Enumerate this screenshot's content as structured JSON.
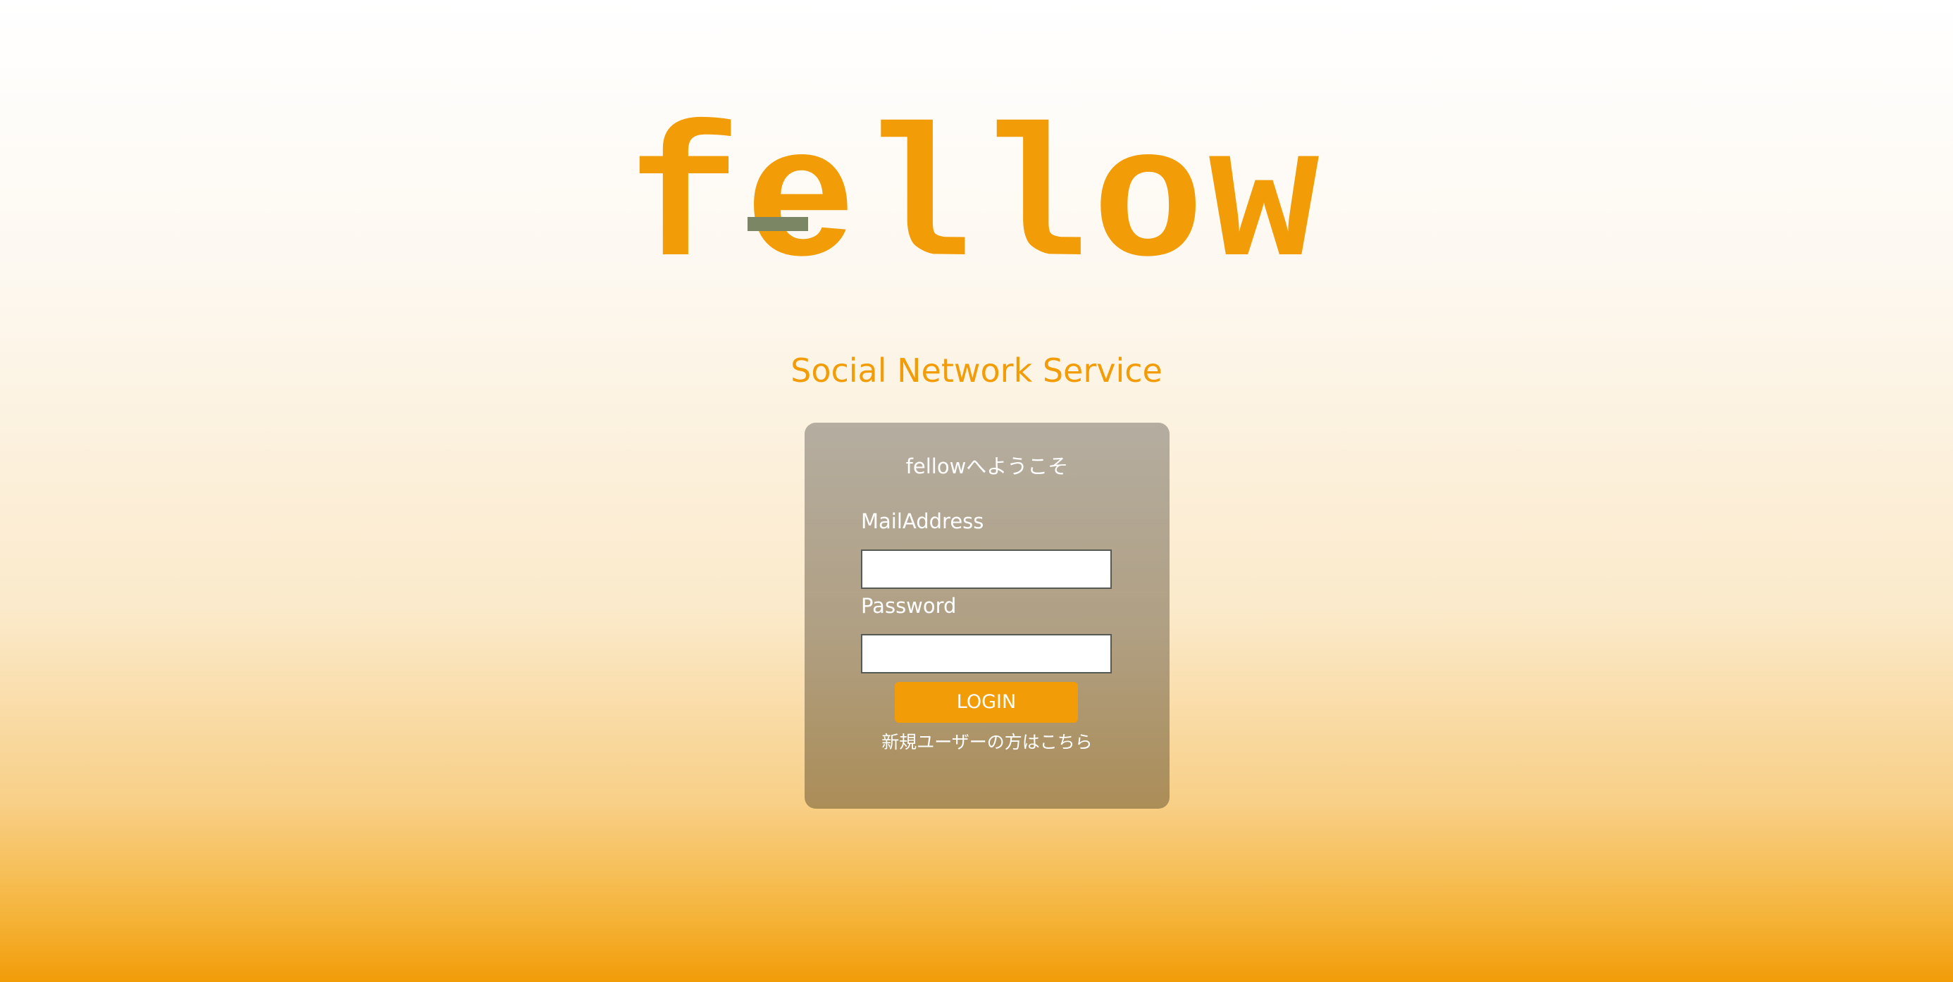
{
  "brand": {
    "logo_text": "fellow",
    "tagline": "Social Network Service"
  },
  "login_form": {
    "welcome": "fellowへようこそ",
    "mail_label": "MailAddress",
    "mail_value": "",
    "password_label": "Password",
    "password_value": "",
    "login_label": "LOGIN",
    "signup_link": "新規ユーザーの方はこちら"
  },
  "colors": {
    "accent": "#f29c08",
    "logo_bar": "#7b8764",
    "card_top": "#b4ada0",
    "card_bottom": "#ab8d57",
    "text_light": "#ffffff"
  }
}
